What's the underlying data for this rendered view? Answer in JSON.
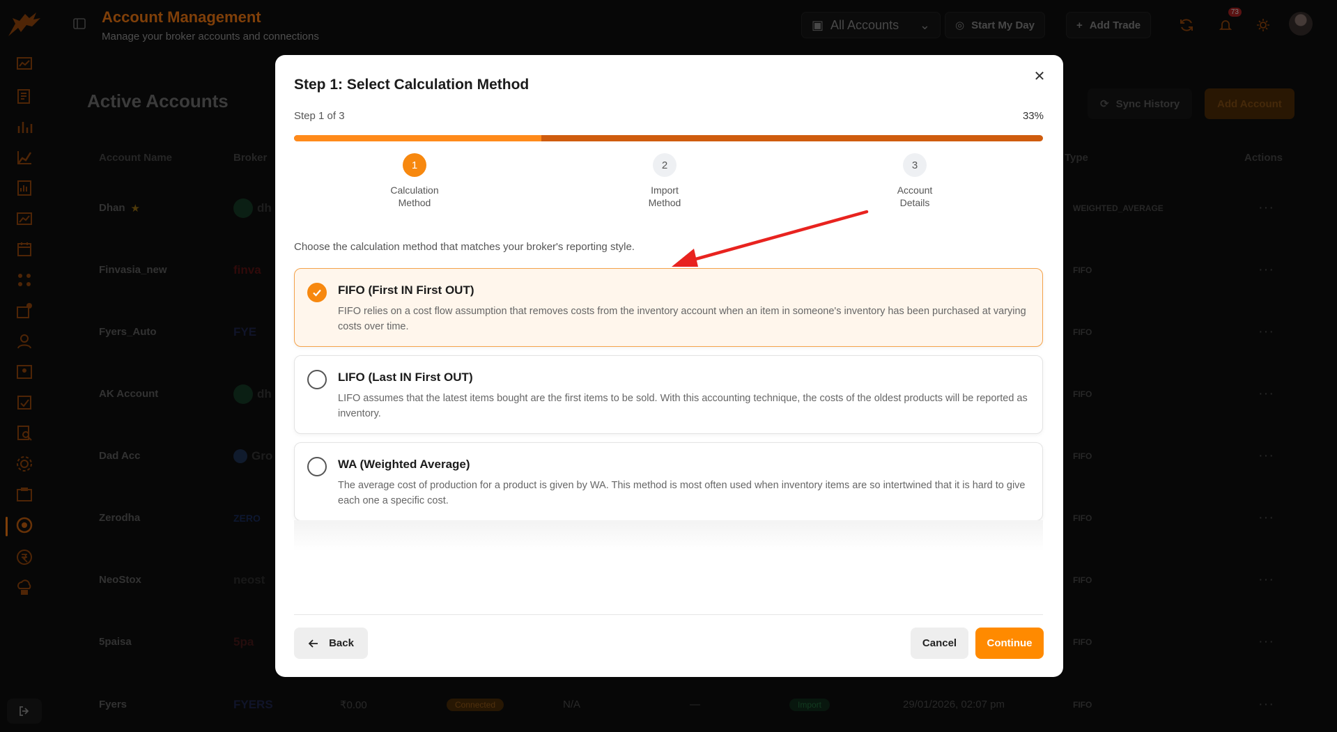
{
  "header": {
    "title": "Account Management",
    "subtitle": "Manage your broker accounts and connections",
    "account_selector": "All Accounts",
    "start_my_day": "Start My Day",
    "add_trade": "Add Trade",
    "notification_count": "73"
  },
  "page": {
    "title": "Active Accounts",
    "sync_history": "Sync History",
    "add_account": "Add Account",
    "columns": [
      "Account Name",
      "Broker",
      "Type",
      "Actions"
    ],
    "rows": [
      {
        "name": "Dhan",
        "broker": "dh",
        "type": "WEIGHTED_AVERAGE",
        "starred": true
      },
      {
        "name": "Finvasia_new",
        "broker": "finva",
        "type": "FIFO"
      },
      {
        "name": "Fyers_Auto",
        "broker": "FYE",
        "type": "FIFO"
      },
      {
        "name": "AK Account",
        "broker": "dh",
        "type": "FIFO"
      },
      {
        "name": "Dad Acc",
        "broker": "Gro",
        "type": "FIFO"
      },
      {
        "name": "Zerodha",
        "broker": "ZERO",
        "type": "FIFO"
      },
      {
        "name": "NeoStox",
        "broker": "neost",
        "type": "FIFO"
      },
      {
        "name": "5paisa",
        "broker": "5pa",
        "type": "FIFO"
      },
      {
        "name": "Fyers",
        "broker": "FYERS",
        "type": "FIFO",
        "balance": "₹0.00",
        "status": "Connected",
        "sync": "N/A",
        "dash": "—",
        "source": "Import",
        "date": "29/01/2026, 02:07 pm"
      }
    ]
  },
  "modal": {
    "title": "Step 1: Select Calculation Method",
    "step_of": "Step 1 of 3",
    "percent_text": "33%",
    "progress": 0.33,
    "steps": [
      {
        "number": "1",
        "label": "Calculation Method"
      },
      {
        "number": "2",
        "label": "Import Method"
      },
      {
        "number": "3",
        "label": "Account Details"
      }
    ],
    "intro": "Choose the calculation method that matches your broker's reporting style.",
    "options": [
      {
        "title": "FIFO (First IN First OUT)",
        "desc": "FIFO relies on a cost flow assumption that removes costs from the inventory account when an item in someone's inventory has been purchased at varying costs over time.",
        "selected": true
      },
      {
        "title": "LIFO (Last IN First OUT)",
        "desc": "LIFO assumes that the latest items bought are the first items to be sold. With this accounting technique, the costs of the oldest products will be reported as inventory.",
        "selected": false
      },
      {
        "title": "WA (Weighted Average)",
        "desc": "The average cost of production for a product is given by WA. This method is most often used when inventory items are so intertwined that it is hard to give each one a specific cost.",
        "selected": false
      }
    ],
    "back": "Back",
    "cancel": "Cancel",
    "continue": "Continue"
  },
  "colors": {
    "accent": "#ff8a00",
    "progress_rest": "#cf5c0e",
    "annotation_arrow": "#e8231f"
  }
}
